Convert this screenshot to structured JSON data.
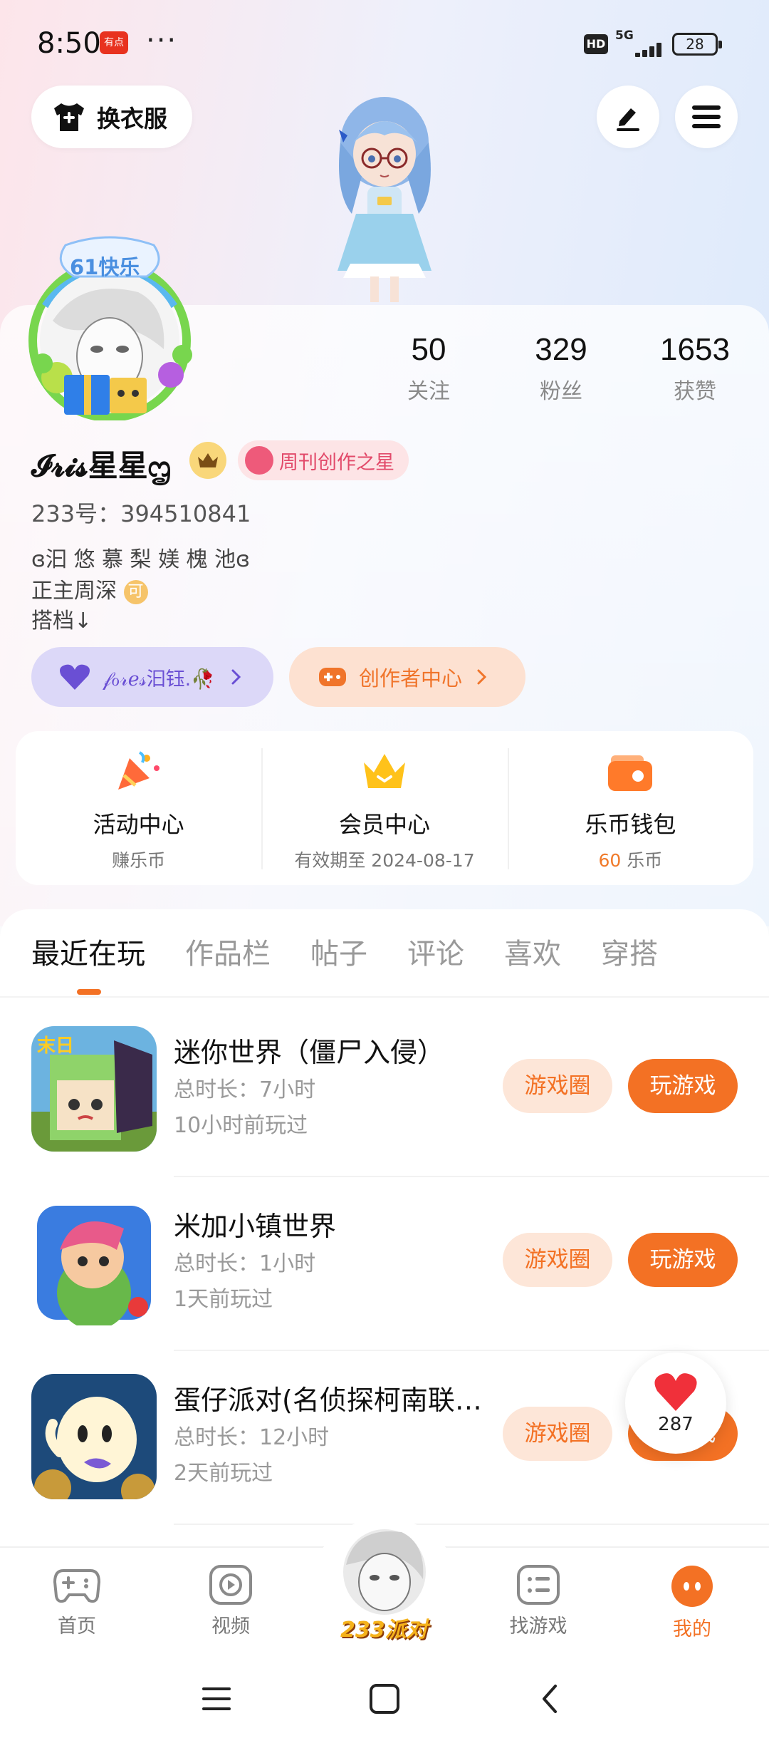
{
  "status_bar": {
    "time": "8:50",
    "app_badge": "有点",
    "dots": "···",
    "hd": "HD",
    "network": "5G",
    "battery": "28"
  },
  "top": {
    "outfit_label": "换衣服"
  },
  "profile": {
    "avatar_badge": "61快乐",
    "stats": [
      {
        "value": "50",
        "label": "关注"
      },
      {
        "value": "329",
        "label": "粉丝"
      },
      {
        "value": "1653",
        "label": "获赞"
      }
    ],
    "username": "𝓘𝓻𝓲𝓼星星ᦗ",
    "star_badge": "周刊创作之星",
    "uid": "233号：394510841",
    "bio_lines": [
      "ɞ汩 悠 慕 梨 媄 槐 池ɞ",
      "正主周深",
      "搭档↓"
    ],
    "bio_emoji": "可",
    "cp_pill": "𝒻ℴ𝓇ℯ𝓈汩钰.🥀",
    "creator_pill": "创作者中心"
  },
  "quick": [
    {
      "title": "活动中心",
      "sub": "赚乐币"
    },
    {
      "title": "会员中心",
      "sub": "有效期至 2024-08-17"
    },
    {
      "title": "乐币钱包",
      "sub_value": "60",
      "sub_unit": " 乐币"
    }
  ],
  "tabs": [
    "最近在玩",
    "作品栏",
    "帖子",
    "评论",
    "喜欢",
    "穿搭"
  ],
  "games": [
    {
      "name": "迷你世界（僵尸入侵）",
      "duration": "总时长：7小时",
      "last_played": "10小时前玩过",
      "circle_label": "游戏圈",
      "play_label": "玩游戏"
    },
    {
      "name": "米加小镇世界",
      "duration": "总时长：1小时",
      "last_played": "1天前玩过",
      "circle_label": "游戏圈",
      "play_label": "玩游戏"
    },
    {
      "name": "蛋仔派对(名侦探柯南联…",
      "duration": "总时长：12小时",
      "last_played": "2天前玩过",
      "circle_label": "游戏圈",
      "play_label": "玩游戏"
    }
  ],
  "like_count": "287",
  "bottom_nav": [
    {
      "label": "首页"
    },
    {
      "label": "视频"
    },
    {
      "label": "233派对"
    },
    {
      "label": "找游戏"
    },
    {
      "label": "我的"
    }
  ],
  "colors": {
    "accent": "#f37124",
    "purple": "#6a4fd4"
  }
}
